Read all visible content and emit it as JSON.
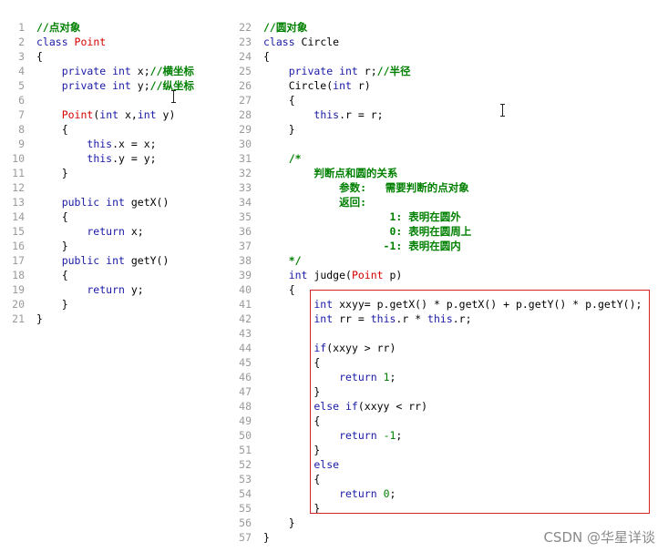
{
  "editor": {
    "left_lines": [
      {
        "n": "1",
        "segs": [
          {
            "t": "//点对象",
            "c": "cm"
          }
        ]
      },
      {
        "n": "2",
        "segs": [
          {
            "t": "class ",
            "c": "kw"
          },
          {
            "t": "Point",
            "c": "cls"
          }
        ]
      },
      {
        "n": "3",
        "segs": [
          {
            "t": "{",
            "c": "pl"
          }
        ]
      },
      {
        "n": "4",
        "segs": [
          {
            "t": "    private int ",
            "c": "kw"
          },
          {
            "t": "x;",
            "c": "pl"
          },
          {
            "t": "//横坐标",
            "c": "cm"
          }
        ]
      },
      {
        "n": "5",
        "segs": [
          {
            "t": "    private int ",
            "c": "kw"
          },
          {
            "t": "y;",
            "c": "pl"
          },
          {
            "t": "//纵坐标",
            "c": "cm"
          }
        ]
      },
      {
        "n": "6",
        "segs": []
      },
      {
        "n": "7",
        "segs": [
          {
            "t": "    ",
            "c": "pl"
          },
          {
            "t": "Point",
            "c": "cls"
          },
          {
            "t": "(",
            "c": "pl"
          },
          {
            "t": "int ",
            "c": "kw"
          },
          {
            "t": "x,",
            "c": "pl"
          },
          {
            "t": "int ",
            "c": "kw"
          },
          {
            "t": "y)",
            "c": "pl"
          }
        ]
      },
      {
        "n": "8",
        "segs": [
          {
            "t": "    {",
            "c": "pl"
          }
        ]
      },
      {
        "n": "9",
        "segs": [
          {
            "t": "        ",
            "c": "pl"
          },
          {
            "t": "this",
            "c": "kw"
          },
          {
            "t": ".x = x;",
            "c": "pl"
          }
        ]
      },
      {
        "n": "10",
        "segs": [
          {
            "t": "        ",
            "c": "pl"
          },
          {
            "t": "this",
            "c": "kw"
          },
          {
            "t": ".y = y;",
            "c": "pl"
          }
        ]
      },
      {
        "n": "11",
        "segs": [
          {
            "t": "    }",
            "c": "pl"
          }
        ]
      },
      {
        "n": "12",
        "segs": []
      },
      {
        "n": "13",
        "segs": [
          {
            "t": "    public int ",
            "c": "kw"
          },
          {
            "t": "getX()",
            "c": "pl"
          }
        ]
      },
      {
        "n": "14",
        "segs": [
          {
            "t": "    {",
            "c": "pl"
          }
        ]
      },
      {
        "n": "15",
        "segs": [
          {
            "t": "        return ",
            "c": "kw"
          },
          {
            "t": "x;",
            "c": "pl"
          }
        ]
      },
      {
        "n": "16",
        "segs": [
          {
            "t": "    }",
            "c": "pl"
          }
        ]
      },
      {
        "n": "17",
        "segs": [
          {
            "t": "    public int ",
            "c": "kw"
          },
          {
            "t": "getY()",
            "c": "pl"
          }
        ]
      },
      {
        "n": "18",
        "segs": [
          {
            "t": "    {",
            "c": "pl"
          }
        ]
      },
      {
        "n": "19",
        "segs": [
          {
            "t": "        return ",
            "c": "kw"
          },
          {
            "t": "y;",
            "c": "pl"
          }
        ]
      },
      {
        "n": "20",
        "segs": [
          {
            "t": "    }",
            "c": "pl"
          }
        ]
      },
      {
        "n": "21",
        "segs": [
          {
            "t": "}",
            "c": "pl"
          }
        ]
      }
    ],
    "right_lines": [
      {
        "n": "22",
        "segs": [
          {
            "t": "//圆对象",
            "c": "cm"
          }
        ]
      },
      {
        "n": "23",
        "segs": [
          {
            "t": "class ",
            "c": "kw"
          },
          {
            "t": "Circle",
            "c": "pl"
          }
        ]
      },
      {
        "n": "24",
        "segs": [
          {
            "t": "{",
            "c": "pl"
          }
        ]
      },
      {
        "n": "25",
        "segs": [
          {
            "t": "    private int ",
            "c": "kw"
          },
          {
            "t": "r;",
            "c": "pl"
          },
          {
            "t": "//半径",
            "c": "cm"
          }
        ]
      },
      {
        "n": "26",
        "segs": [
          {
            "t": "    Circle(",
            "c": "pl"
          },
          {
            "t": "int ",
            "c": "kw"
          },
          {
            "t": "r)",
            "c": "pl"
          }
        ]
      },
      {
        "n": "27",
        "segs": [
          {
            "t": "    {",
            "c": "pl"
          }
        ]
      },
      {
        "n": "28",
        "segs": [
          {
            "t": "        ",
            "c": "pl"
          },
          {
            "t": "this",
            "c": "kw"
          },
          {
            "t": ".r = r;",
            "c": "pl"
          }
        ]
      },
      {
        "n": "29",
        "segs": [
          {
            "t": "    }",
            "c": "pl"
          }
        ]
      },
      {
        "n": "30",
        "segs": []
      },
      {
        "n": "31",
        "segs": [
          {
            "t": "    /*",
            "c": "cm"
          }
        ]
      },
      {
        "n": "32",
        "segs": [
          {
            "t": "        判断点和圆的关系",
            "c": "cm"
          }
        ]
      },
      {
        "n": "33",
        "segs": [
          {
            "t": "            参数:   需要判断的点对象",
            "c": "cm"
          }
        ]
      },
      {
        "n": "34",
        "segs": [
          {
            "t": "            返回:",
            "c": "cm"
          }
        ]
      },
      {
        "n": "35",
        "segs": [
          {
            "t": "                    1: 表明在圆外",
            "c": "cm"
          }
        ]
      },
      {
        "n": "36",
        "segs": [
          {
            "t": "                    0: 表明在圆周上",
            "c": "cm"
          }
        ]
      },
      {
        "n": "37",
        "segs": [
          {
            "t": "                   -1: 表明在圆内",
            "c": "cm"
          }
        ]
      },
      {
        "n": "38",
        "segs": [
          {
            "t": "    */",
            "c": "cm"
          }
        ]
      },
      {
        "n": "39",
        "segs": [
          {
            "t": "    int ",
            "c": "kw"
          },
          {
            "t": "judge(",
            "c": "pl"
          },
          {
            "t": "Point",
            "c": "cls"
          },
          {
            "t": " p)",
            "c": "pl"
          }
        ]
      },
      {
        "n": "40",
        "segs": [
          {
            "t": "    {",
            "c": "pl"
          }
        ]
      },
      {
        "n": "41",
        "segs": [
          {
            "t": "        int ",
            "c": "kw"
          },
          {
            "t": "xxyy= p.getX() * p.getX() + p.getY() * p.getY();",
            "c": "pl"
          }
        ]
      },
      {
        "n": "42",
        "segs": [
          {
            "t": "        int ",
            "c": "kw"
          },
          {
            "t": "rr = ",
            "c": "pl"
          },
          {
            "t": "this",
            "c": "kw"
          },
          {
            "t": ".r * ",
            "c": "pl"
          },
          {
            "t": "this",
            "c": "kw"
          },
          {
            "t": ".r;",
            "c": "pl"
          }
        ]
      },
      {
        "n": "43",
        "segs": []
      },
      {
        "n": "44",
        "segs": [
          {
            "t": "        if",
            "c": "kw"
          },
          {
            "t": "(xxyy > rr)",
            "c": "pl"
          }
        ]
      },
      {
        "n": "45",
        "segs": [
          {
            "t": "        {",
            "c": "pl"
          }
        ]
      },
      {
        "n": "46",
        "segs": [
          {
            "t": "            return ",
            "c": "kw"
          },
          {
            "t": "1",
            "c": "num"
          },
          {
            "t": ";",
            "c": "pl"
          }
        ]
      },
      {
        "n": "47",
        "segs": [
          {
            "t": "        }",
            "c": "pl"
          }
        ]
      },
      {
        "n": "48",
        "segs": [
          {
            "t": "        else if",
            "c": "kw"
          },
          {
            "t": "(xxyy < rr)",
            "c": "pl"
          }
        ]
      },
      {
        "n": "49",
        "segs": [
          {
            "t": "        {",
            "c": "pl"
          }
        ]
      },
      {
        "n": "50",
        "segs": [
          {
            "t": "            return ",
            "c": "kw"
          },
          {
            "t": "-1",
            "c": "num"
          },
          {
            "t": ";",
            "c": "pl"
          }
        ]
      },
      {
        "n": "51",
        "segs": [
          {
            "t": "        }",
            "c": "pl"
          }
        ]
      },
      {
        "n": "52",
        "segs": [
          {
            "t": "        else",
            "c": "kw"
          }
        ]
      },
      {
        "n": "53",
        "segs": [
          {
            "t": "        {",
            "c": "pl"
          }
        ]
      },
      {
        "n": "54",
        "segs": [
          {
            "t": "            return ",
            "c": "kw"
          },
          {
            "t": "0",
            "c": "num"
          },
          {
            "t": ";",
            "c": "pl"
          }
        ]
      },
      {
        "n": "55",
        "segs": [
          {
            "t": "        }",
            "c": "pl"
          }
        ]
      },
      {
        "n": "56",
        "segs": [
          {
            "t": "    }",
            "c": "pl"
          }
        ]
      },
      {
        "n": "57",
        "segs": [
          {
            "t": "}",
            "c": "pl"
          }
        ]
      }
    ]
  },
  "watermark": "CSDN @华星详谈",
  "colors": {
    "keyword": "#1a1aa6",
    "class_name": "#d40000",
    "comment": "#008000",
    "highlight_border": "#d42424",
    "line_number": "#9a9a9a"
  }
}
